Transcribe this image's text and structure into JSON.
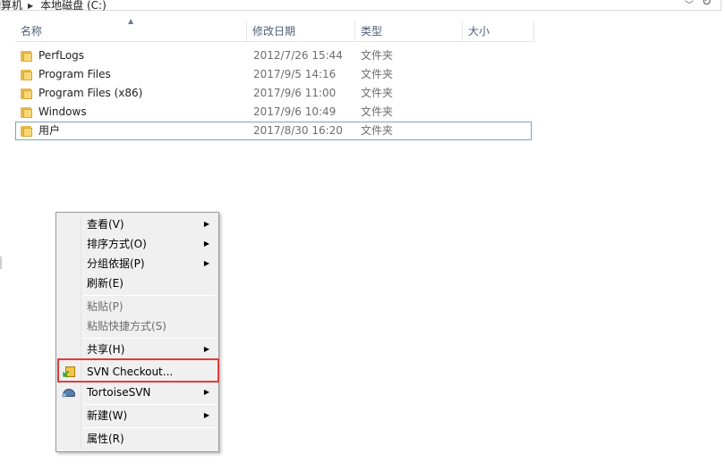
{
  "address": {
    "crumbs": [
      "计算机",
      "本地磁盘 (C:)"
    ],
    "dropdown_icon": "chevron-down",
    "refresh_icon": "refresh"
  },
  "columns": {
    "name": "名称",
    "date": "修改日期",
    "type": "类型",
    "size": "大小"
  },
  "files": [
    {
      "name": "PerfLogs",
      "date": "2012/7/26 15:44",
      "type": "文件夹"
    },
    {
      "name": "Program Files",
      "date": "2017/9/5 14:16",
      "type": "文件夹"
    },
    {
      "name": "Program Files (x86)",
      "date": "2017/9/6 11:00",
      "type": "文件夹"
    },
    {
      "name": "Windows",
      "date": "2017/9/6 10:49",
      "type": "文件夹"
    },
    {
      "name": "用户",
      "date": "2017/8/30 16:20",
      "type": "文件夹"
    }
  ],
  "context_menu": {
    "view": "查看(V)",
    "sort": "排序方式(O)",
    "group": "分组依据(P)",
    "refresh": "刷新(E)",
    "paste": "粘贴(P)",
    "paste_shortcut": "粘贴快捷方式(S)",
    "share": "共享(H)",
    "svn_checkout": "SVN Checkout...",
    "tortoisesvn": "TortoiseSVN",
    "new": "新建(W)",
    "properties": "属性(R)"
  },
  "colors": {
    "highlight_border": "#e23b3b",
    "selection_border": "#7da2ce",
    "header_text": "#4c607a"
  }
}
